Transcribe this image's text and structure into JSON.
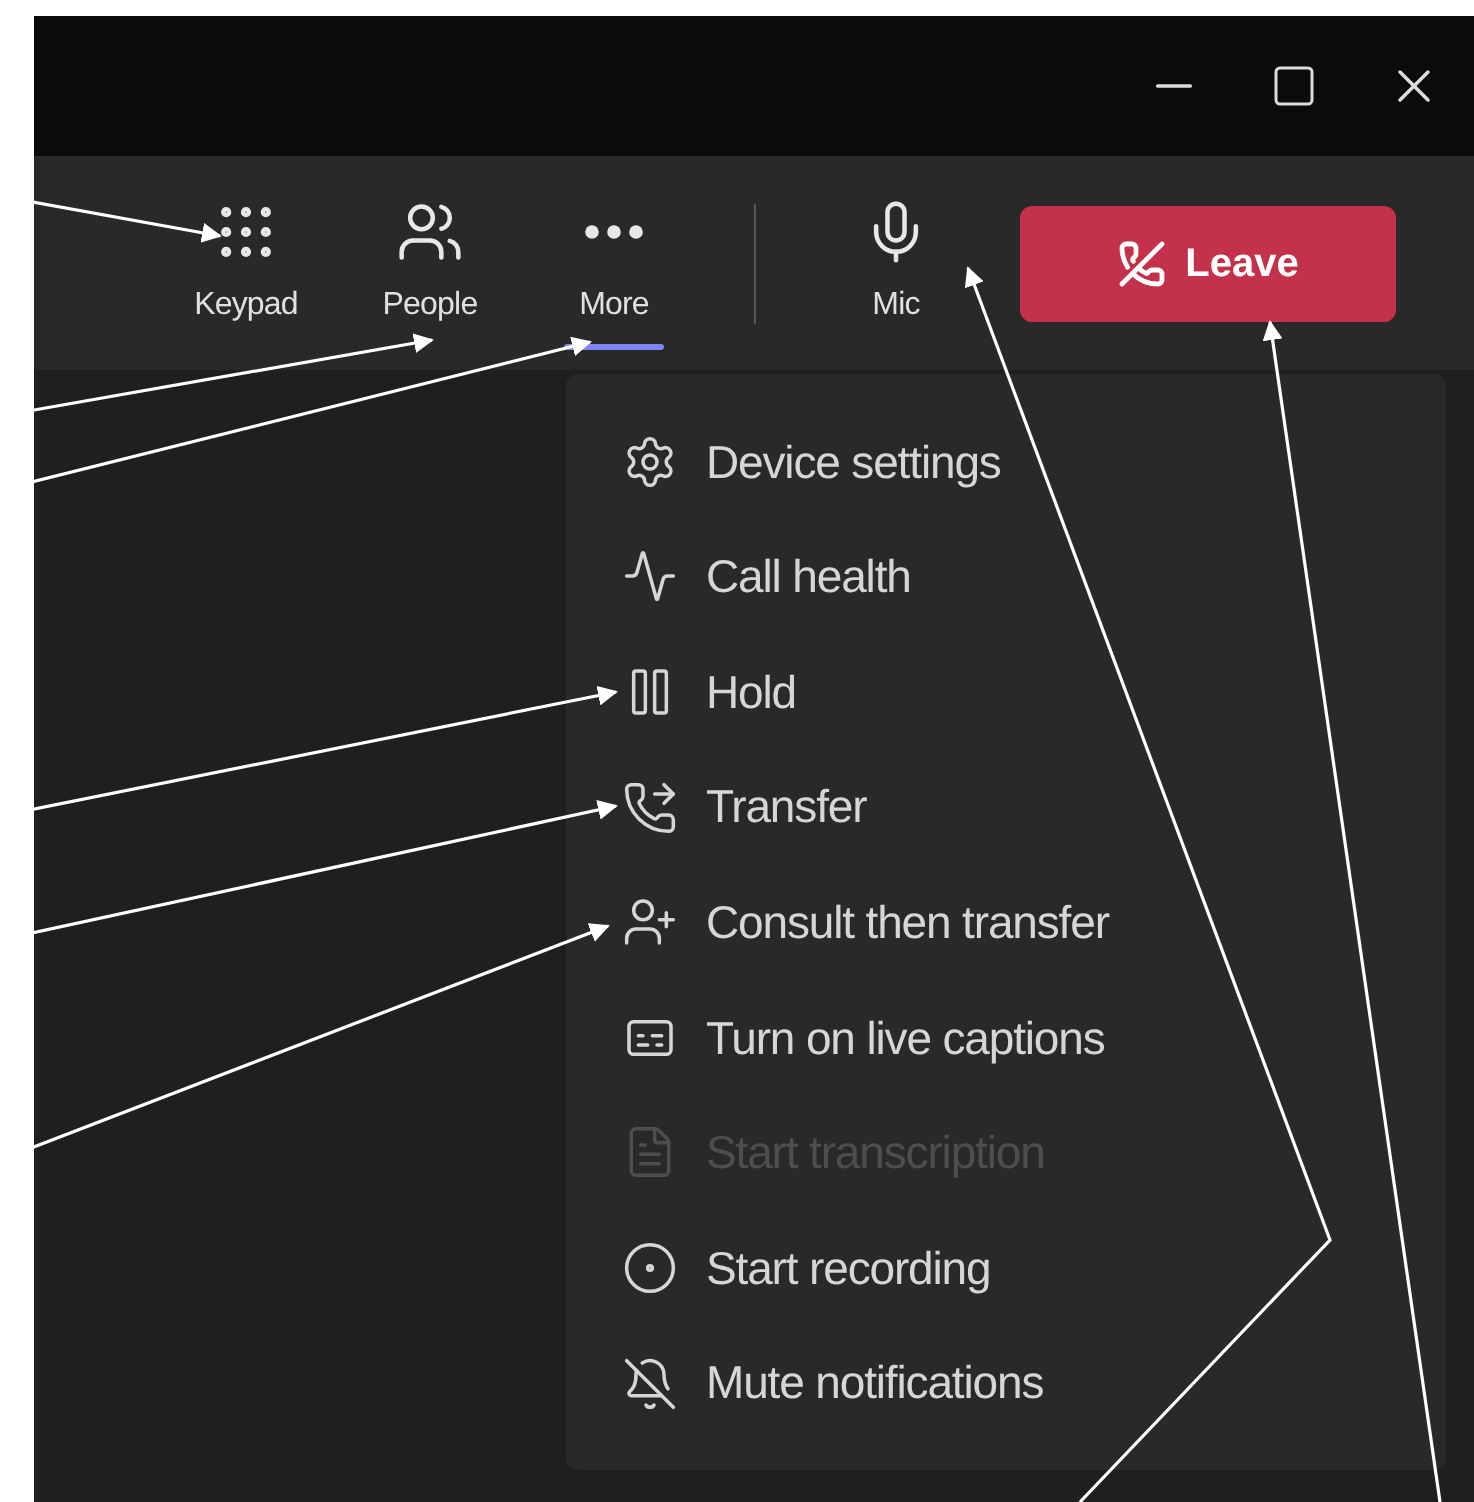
{
  "toolbar": {
    "items": [
      {
        "kind": "keypad",
        "label": "Keypad",
        "selected": false
      },
      {
        "kind": "people",
        "label": "People",
        "selected": false
      },
      {
        "kind": "more",
        "label": "More",
        "selected": true
      },
      {
        "kind": "mic",
        "label": "Mic",
        "selected": false
      }
    ],
    "leave_button": {
      "label": "Leave"
    }
  },
  "more_menu": {
    "items": [
      {
        "kind": "settings",
        "label": "Device settings",
        "disabled": false
      },
      {
        "kind": "health",
        "label": "Call health",
        "disabled": false
      },
      {
        "kind": "hold",
        "label": "Hold",
        "disabled": false
      },
      {
        "kind": "transfer",
        "label": "Transfer",
        "disabled": false
      },
      {
        "kind": "consult",
        "label": "Consult then transfer",
        "disabled": false
      },
      {
        "kind": "captions",
        "label": "Turn on live captions",
        "disabled": false
      },
      {
        "kind": "transcription",
        "label": "Start transcription",
        "disabled": true
      },
      {
        "kind": "record",
        "label": "Start recording",
        "disabled": false
      },
      {
        "kind": "mute",
        "label": "Mute notifications",
        "disabled": false
      }
    ]
  }
}
